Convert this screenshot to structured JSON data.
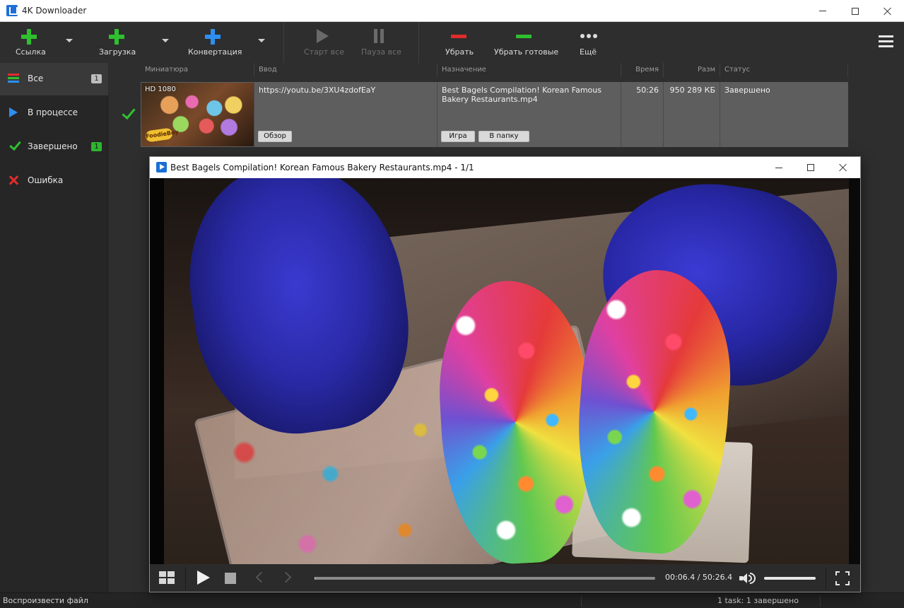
{
  "app": {
    "title": "4K Downloader"
  },
  "toolbar": {
    "link_label": "Ссылка",
    "load_label": "Загрузка",
    "convert_label": "Конвертация",
    "start_all_label": "Старт все",
    "pause_all_label": "Пауза все",
    "remove_label": "Убрать",
    "remove_done_label": "Убрать готовые",
    "more_label": "Ещё"
  },
  "colors": {
    "add_green": "#2fbf2f",
    "add_blue": "#2d8ff0",
    "remove_red": "#e02c2c",
    "remove_green": "#2fbf2f"
  },
  "sidebar": {
    "items": [
      {
        "label": "Все",
        "count": "1",
        "icon": "list-icon"
      },
      {
        "label": "В процессе",
        "count": "",
        "icon": "play-triangle-icon"
      },
      {
        "label": "Завершено",
        "count": "1",
        "icon": "checkmark-icon"
      },
      {
        "label": "Ошибка",
        "count": "",
        "icon": "error-x-icon"
      }
    ]
  },
  "table": {
    "headers": {
      "thumb": "Миниатюра",
      "input": "Ввод",
      "dest": "Назначение",
      "time": "Время",
      "size": "Разм",
      "status": "Статус"
    },
    "rows": [
      {
        "quality": "HD 1080",
        "thumb_logo": "FoodieBoy",
        "input": "https://youtu.be/3XU4zdofEaY",
        "browse_label": "Обзор",
        "dest": "Best Bagels Compilation! Korean Famous Bakery Restaurants.mp4",
        "play_label": "Игра",
        "folder_label": "В папку",
        "time": "50:26",
        "size": "950 289 КБ",
        "status": "Завершено"
      }
    ]
  },
  "player": {
    "title": "Best Bagels Compilation! Korean Famous Bakery Restaurants.mp4 - 1/1",
    "time": "00:06.4 / 50:26.4",
    "progress": 0.002,
    "volume": 1.0
  },
  "statusbar": {
    "left": "Воспроизвести файл",
    "right": "1 task: 1 завершено"
  }
}
